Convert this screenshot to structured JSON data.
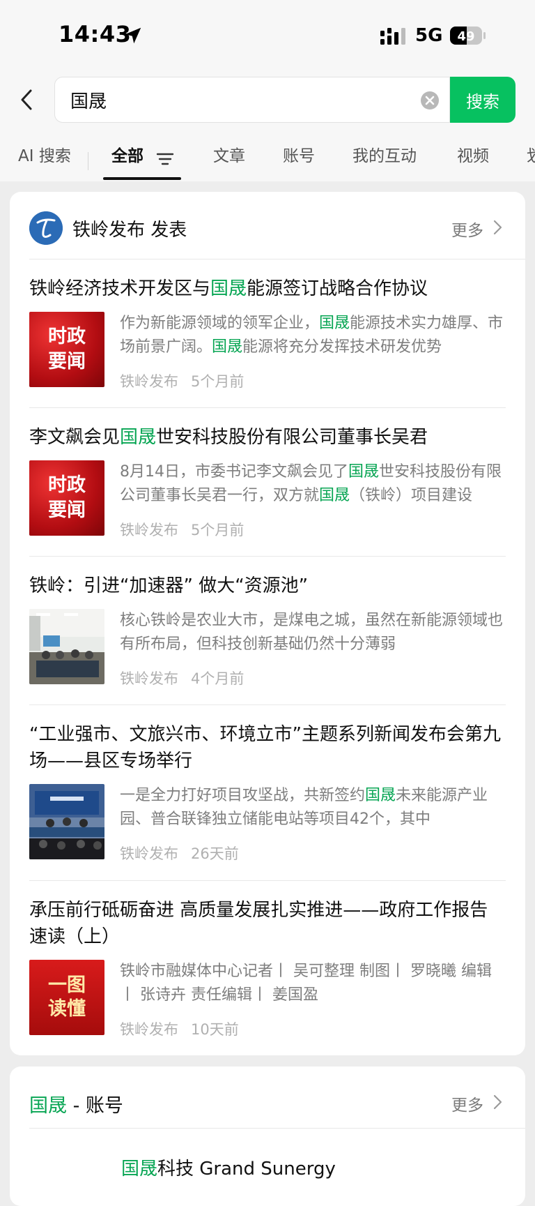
{
  "status_bar": {
    "time": "14:43",
    "network": "5G",
    "battery": "49"
  },
  "search": {
    "value": "国晟",
    "button_label": "搜索"
  },
  "tabs": [
    {
      "label": "AI 搜索"
    },
    {
      "label": "全部"
    },
    {
      "label": "文章"
    },
    {
      "label": "账号"
    },
    {
      "label": "我的互动"
    },
    {
      "label": "视频"
    },
    {
      "label": "划"
    }
  ],
  "source_card": {
    "source": "铁岭发布 发表",
    "more_label": "更多"
  },
  "articles": [
    {
      "title": [
        "铁岭经济技术开发区与",
        "国晟",
        "能源签订战略合作协议"
      ],
      "snippet": [
        "作为新能源领域的领军企业，",
        "国晟",
        "能源技术实力雄厚、市场前景广阔。",
        "国晟",
        "能源将充分发挥技术研发优势"
      ],
      "thumb_text": [
        "时政",
        "要闻"
      ],
      "source": "铁岭发布",
      "time": "5个月前"
    },
    {
      "title": [
        "李文飙会见",
        "国晟",
        "世安科技股份有限公司董事长吴君"
      ],
      "snippet": [
        "8月14日，市委书记李文飙会见了",
        "国晟",
        "世安科技股份有限公司董事长吴君一行，双方就",
        "国晟",
        "（铁岭）项目建设"
      ],
      "thumb_text": [
        "时政",
        "要闻"
      ],
      "source": "铁岭发布",
      "time": "5个月前"
    },
    {
      "title": [
        "铁岭：引进“加速器” 做大“资源池”"
      ],
      "snippet": [
        "核心铁岭是农业大市，是煤电之城，虽然在新能源领域也有所布局，但科技创新基础仍然十分薄弱"
      ],
      "source": "铁岭发布",
      "time": "4个月前"
    },
    {
      "title": [
        "“工业强市、文旅兴市、环境立市”主题系列新闻发布会第九场——县区专场举行"
      ],
      "snippet": [
        "一是全力打好项目攻坚战，共新签约",
        "国晟",
        "未来能源产业园、普合联锋独立储能电站等项目42个，其中"
      ],
      "source": "铁岭发布",
      "time": "26天前"
    },
    {
      "title": [
        "承压前行砥砺奋进 高质量发展扎实推进——政府工作报告速读（上）"
      ],
      "snippet": [
        "铁岭市融媒体中心记者丨 吴可整理 制图丨 罗晓曦 编辑丨 张诗卉 责任编辑丨 姜国盈"
      ],
      "thumb_text": [
        "一图",
        "读懂"
      ],
      "source": "铁岭发布",
      "time": "10天前"
    }
  ],
  "account_card": {
    "title": [
      "国晟",
      " - 账号"
    ],
    "more_label": "更多",
    "name": [
      "国晟",
      "科技 Grand Sunergy"
    ]
  },
  "colors": {
    "accent": "#07c160",
    "highlight": "#07a553"
  }
}
